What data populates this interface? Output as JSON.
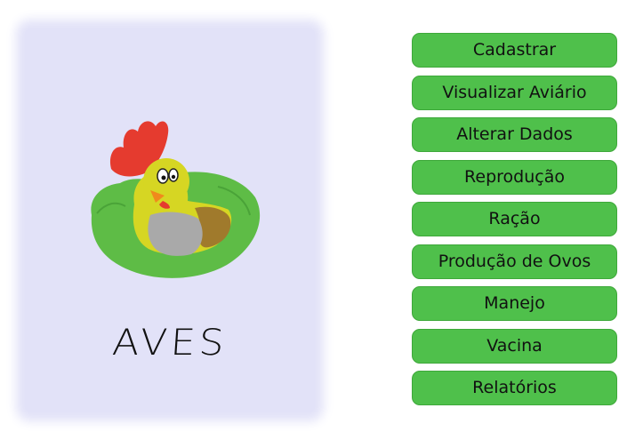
{
  "card": {
    "title": "AVES",
    "logo_icon": "chicken-nest-icon",
    "background_color": "#e2e2f8"
  },
  "menu": {
    "button_color": "#4fc04b",
    "items": [
      {
        "label": "Cadastrar"
      },
      {
        "label": "Visualizar Aviário"
      },
      {
        "label": "Alterar Dados"
      },
      {
        "label": "Reprodução"
      },
      {
        "label": "Ração"
      },
      {
        "label": "Produção de Ovos"
      },
      {
        "label": "Manejo"
      },
      {
        "label": "Vacina"
      },
      {
        "label": "Relatórios"
      }
    ]
  }
}
